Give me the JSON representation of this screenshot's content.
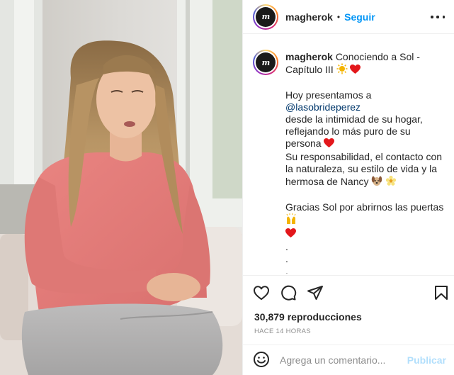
{
  "post": {
    "username": "magherok",
    "avatar_letter": "m",
    "follow_label": "Seguir",
    "header_separator": "•"
  },
  "caption": {
    "username": "magherok",
    "title": "Conociendo a Sol - Capítulo III",
    "intro": "Hoy presentamos a",
    "mention": "@lasobrideperez",
    "line2": "desde la intimidad de su hogar,",
    "line3": "reflejando lo más puro de su persona",
    "line4": "Su responsabilidad, el contacto con la naturaleza, su estilo de vida y la hermosa de Nancy",
    "thanks": "Gracias Sol por abrirnos las puertas",
    "dots": [
      ".",
      ".",
      ".",
      ".",
      ".",
      ".",
      "."
    ]
  },
  "stats": {
    "views": "30,879 reproducciones",
    "time_ago": "HACE 14 HORAS"
  },
  "comment": {
    "placeholder": "Agrega un comentario...",
    "publish_label": "Publicar"
  },
  "icons": {
    "more": "more-options-icon",
    "like": "heart-outline-icon",
    "comment": "comment-bubble-icon",
    "share": "paper-plane-icon",
    "save": "bookmark-icon",
    "emoji": "smiley-face-icon",
    "sun": "sun-emoji",
    "heart": "red-heart-emoji",
    "dog": "dog-emoji",
    "flower": "blossom-emoji",
    "hands": "raised-hands-emoji"
  },
  "colors": {
    "accent": "#0095f6",
    "publish_disabled": "#b2dffc",
    "heart": "#e3171b",
    "mention": "#00376b",
    "muted": "#8e8e8e"
  }
}
